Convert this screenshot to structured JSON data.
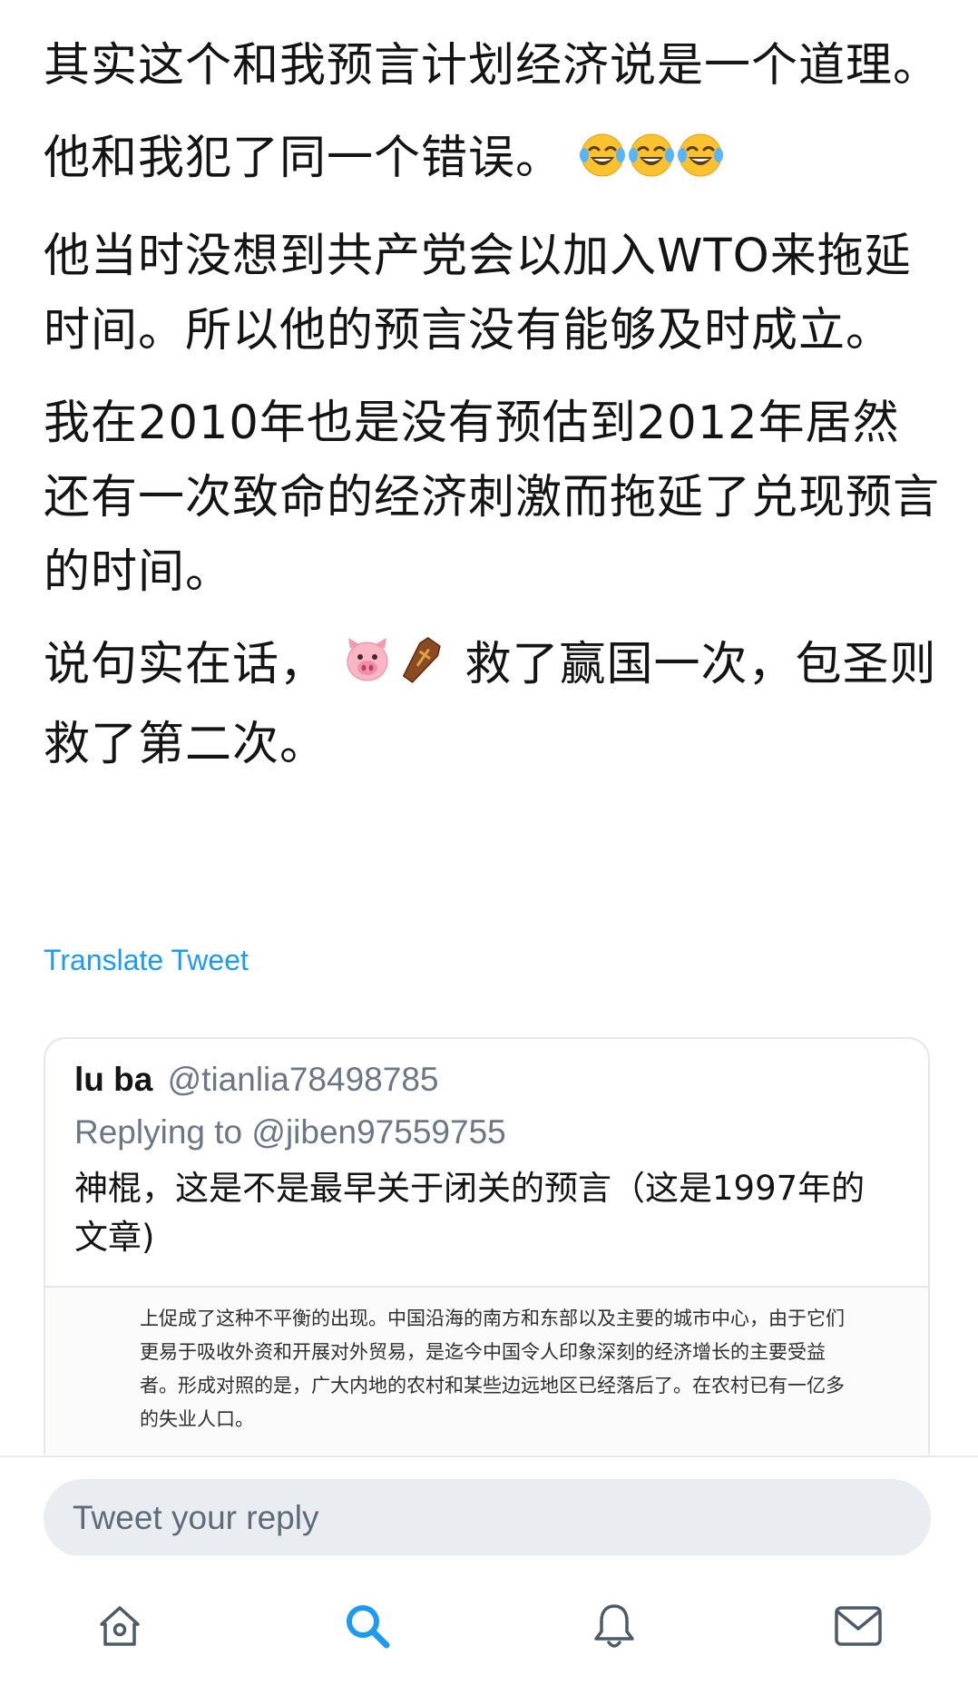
{
  "tweet": {
    "paragraphs": [
      {
        "text": "其实这个和我预言计划经济说是一个道理。",
        "emojis": []
      },
      {
        "text": "他和我犯了同一个错误。",
        "emojis": [
          "tears-of-joy",
          "tears-of-joy",
          "tears-of-joy"
        ]
      },
      {
        "text": "他当时没想到共产党会以加入WTO来拖延时间。所以他的预言没有能够及时成立。",
        "emojis": []
      },
      {
        "text": "我在2010年也是没有预估到2012年居然还有一次致命的经济刺激而拖延了兑现预言的时间。",
        "emojis": []
      }
    ],
    "last_paragraph": {
      "before": "说句实在话，",
      "emojis": [
        "pig-face",
        "coffin"
      ],
      "after": "救了赢国一次，包圣则救了第二次。"
    },
    "translate_label": "Translate Tweet"
  },
  "quoted_tweet": {
    "name": "lu ba",
    "handle": "@tianlia78498785",
    "replying_to": "Replying to @jiben97559755",
    "text": "神棍，这是不是最早关于闭关的预言（这是1997年的文章)",
    "image_text": "上促成了这种不平衡的出现。中国沿海的南方和东部以及主要的城市中心，由于它们更易于吸收外资和开展对外贸易，是迄今中国令人印象深刻的经济增长的主要受益者。形成对照的是，广大内地的农村和某些边远地区已经落后了。在农村已有一亿多的失业人口。"
  },
  "reply": {
    "placeholder": "Tweet your reply"
  },
  "tab_bar": {
    "tabs": [
      {
        "icon": "home-icon",
        "active": false
      },
      {
        "icon": "search-icon",
        "active": true
      },
      {
        "icon": "bell-icon",
        "active": false
      },
      {
        "icon": "mail-icon",
        "active": false
      }
    ]
  },
  "colors": {
    "accent": "#1d9bf0",
    "text": "#141414",
    "muted": "#6b7785",
    "icon": "#4d5b69",
    "input_bg": "#e9ecf0"
  }
}
